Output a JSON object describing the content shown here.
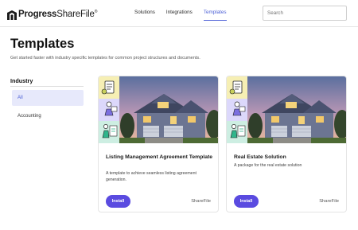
{
  "header": {
    "logo_brand": "Progress",
    "logo_product": "ShareFile",
    "logo_tm": "®",
    "nav": [
      {
        "label": "Solutions",
        "active": false
      },
      {
        "label": "Integrations",
        "active": false
      },
      {
        "label": "Templates",
        "active": true
      }
    ],
    "search_placeholder": "Search"
  },
  "page": {
    "title": "Templates",
    "subtitle": "Get started faster with industry specific templates for common project structures and documents."
  },
  "filters": {
    "heading": "Industry",
    "items": [
      {
        "label": "All",
        "selected": true
      },
      {
        "label": "Accounting",
        "selected": false
      }
    ]
  },
  "cards": [
    {
      "title": "Listing Management Agreement Template",
      "description": "A template to achieve seamless listing agreement generation.",
      "button": "Install",
      "brand": "ShareFile",
      "image": "house-photo-with-icon-tiles"
    },
    {
      "title": "Real Estate Solution",
      "description": "A package for the real estate solution",
      "button": "Install",
      "brand": "ShareFile",
      "image": "house-photo-with-icon-tiles"
    }
  ],
  "colors": {
    "accent": "#4b5fd6",
    "button": "#5a4be0",
    "selected_bg": "#e7e9fb"
  }
}
